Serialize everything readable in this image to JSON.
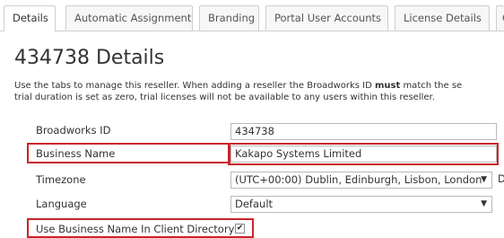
{
  "tabs": [
    {
      "label": "Details",
      "active": true
    },
    {
      "label": "Automatic Assignment",
      "active": false
    },
    {
      "label": "Branding",
      "active": false
    },
    {
      "label": "Portal User Accounts",
      "active": false
    },
    {
      "label": "License Details",
      "active": false
    },
    {
      "label": "Gr",
      "active": false
    }
  ],
  "page": {
    "title": "434738 Details",
    "description": {
      "line1_before": "Use the tabs to manage this reseller. When adding a reseller the Broadworks ID ",
      "line1_bold": "must",
      "line1_after": " match the se",
      "line2": "trial duration is set as zero, trial licenses will not be available to any users within this reseller."
    }
  },
  "form": {
    "broadworks_id": {
      "label": "Broadworks ID",
      "value": "434738"
    },
    "business_name": {
      "label": "Business Name",
      "value": "Kakapo Systems Limited"
    },
    "timezone": {
      "label": "Timezone",
      "value": "(UTC+00:00) Dublin, Edinburgh, Lisbon, London",
      "trailing": "D"
    },
    "language": {
      "label": "Language",
      "value": "Default"
    },
    "use_business_name": {
      "label": "Use Business Name In Client Directory",
      "checked": true
    }
  },
  "icons": {
    "dropdown": "chevron-down-icon",
    "check": "checkmark-icon"
  },
  "colors": {
    "highlight": "#c8242a",
    "border": "#cfcfcf",
    "text": "#333333"
  }
}
